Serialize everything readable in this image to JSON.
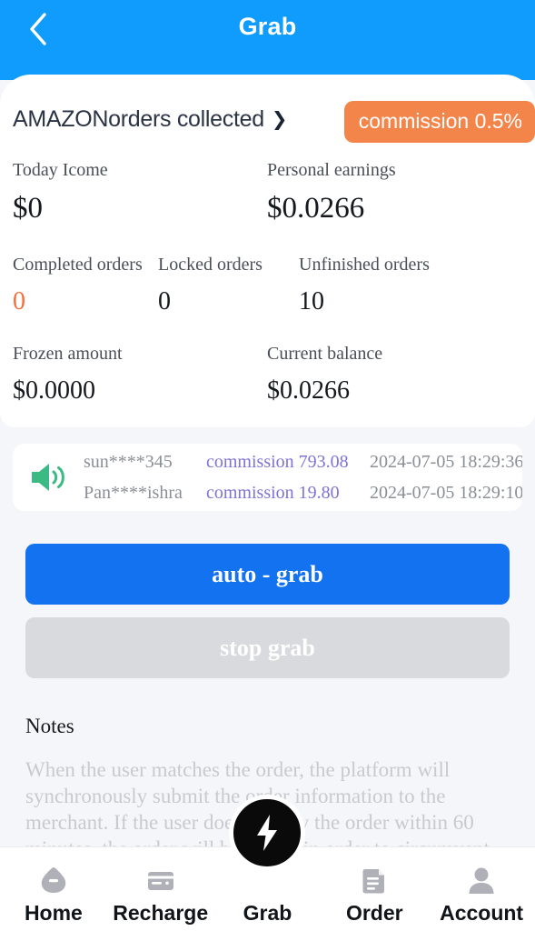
{
  "header": {
    "title": "Grab",
    "back_icon": "chevron-left-icon",
    "background_color": "#0f9cfc"
  },
  "card": {
    "shop_label": "AMAZONorders collected",
    "shop_chevron": "❯",
    "commission_badge": "commission 0.5%",
    "badge_color": "#f4854a",
    "stats": {
      "row1": [
        {
          "label": "Today Icome",
          "value": "$0"
        },
        {
          "label": "Personal earnings",
          "value": "$0.0266"
        }
      ],
      "row2": [
        {
          "label": "Completed orders",
          "value": "0",
          "value_color": "#f4703b"
        },
        {
          "label": "Locked orders",
          "value": "0"
        },
        {
          "label": "Unfinished orders",
          "value": "10"
        }
      ],
      "row3": [
        {
          "label": "Frozen amount",
          "value": "$0.0000"
        },
        {
          "label": "Current balance",
          "value": "$0.0266"
        }
      ]
    }
  },
  "notice": {
    "icon": "speaker-icon",
    "icon_color": "#3bba84",
    "rows": [
      {
        "user": "sun****345",
        "commission": "commission 793.08",
        "time": "2024-07-05 18:29:36"
      },
      {
        "user": "Pan****ishra",
        "commission": "commission 19.80",
        "time": "2024-07-05 18:29:10"
      }
    ],
    "commission_color": "#7d74d6"
  },
  "actions": {
    "auto_grab_label": "auto - grab",
    "auto_grab_color": "#1272f0",
    "stop_grab_label": "stop grab",
    "stop_grab_color": "#d9dadd"
  },
  "notes": {
    "title": "Notes",
    "body": "When the user matches the order, the platform will synchronously submit the order information to the merchant. If the user does not pay the order within 60  minutes, the order will be frozen in order to circumvent the supervision of"
  },
  "tabbar": {
    "items": [
      {
        "label": "Home",
        "icon": "home-icon"
      },
      {
        "label": "Recharge",
        "icon": "credit-card-icon"
      },
      {
        "label": "Grab",
        "icon": "lightning-bolt-icon"
      },
      {
        "label": "Order",
        "icon": "document-icon"
      },
      {
        "label": "Account",
        "icon": "person-icon"
      }
    ]
  }
}
